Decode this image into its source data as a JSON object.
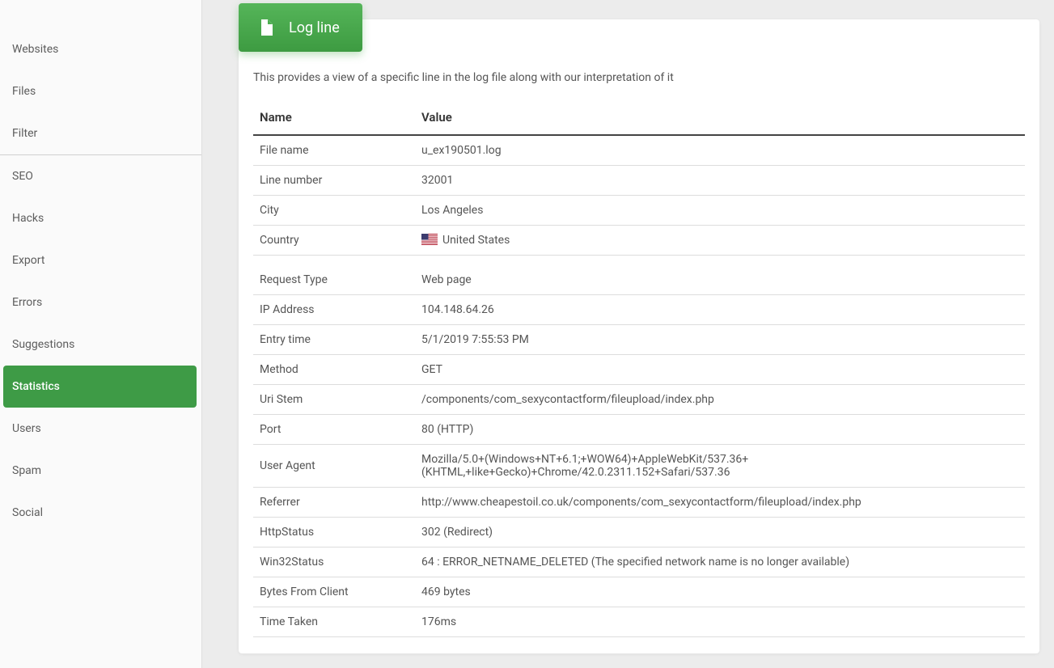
{
  "sidebar": {
    "items": [
      {
        "label": "Websites"
      },
      {
        "label": "Files"
      },
      {
        "label": "Filter"
      },
      {
        "label": "SEO"
      },
      {
        "label": "Hacks"
      },
      {
        "label": "Export"
      },
      {
        "label": "Errors"
      },
      {
        "label": "Suggestions"
      },
      {
        "label": "Statistics",
        "active": true
      },
      {
        "label": "Users"
      },
      {
        "label": "Spam"
      },
      {
        "label": "Social"
      }
    ]
  },
  "header": {
    "title": "Log line"
  },
  "description": "This provides a view of a specific line in the log file along with our interpretation of it",
  "table": {
    "columns": {
      "name": "Name",
      "value": "Value"
    },
    "rows": [
      {
        "name": "File name",
        "value": "u_ex190501.log"
      },
      {
        "name": "Line number",
        "value": "32001"
      },
      {
        "name": "City",
        "value": "Los Angeles"
      },
      {
        "name": "Country",
        "value": "United States",
        "flag": "us"
      },
      {
        "spacer": true
      },
      {
        "name": "Request Type",
        "value": "Web page"
      },
      {
        "name": "IP Address",
        "value": "104.148.64.26"
      },
      {
        "name": "Entry time",
        "value": "5/1/2019 7:55:53 PM"
      },
      {
        "name": "Method",
        "value": "GET"
      },
      {
        "name": "Uri Stem",
        "value": "/components/com_sexycontactform/fileupload/index.php"
      },
      {
        "name": "Port",
        "value": "80 (HTTP)"
      },
      {
        "name": "User Agent",
        "value": "Mozilla/5.0+(Windows+NT+6.1;+WOW64)+AppleWebKit/537.36+(KHTML,+like+Gecko)+Chrome/42.0.2311.152+Safari/537.36"
      },
      {
        "name": "Referrer",
        "value": "http://www.cheapestoil.co.uk/components/com_sexycontactform/fileupload/index.php"
      },
      {
        "name": "HttpStatus",
        "value": "302 (Redirect)"
      },
      {
        "name": "Win32Status",
        "value": "64 : ERROR_NETNAME_DELETED (The specified network name is no longer available)"
      },
      {
        "name": "Bytes From Client",
        "value": "469 bytes"
      },
      {
        "name": "Time Taken",
        "value": "176ms"
      }
    ]
  }
}
